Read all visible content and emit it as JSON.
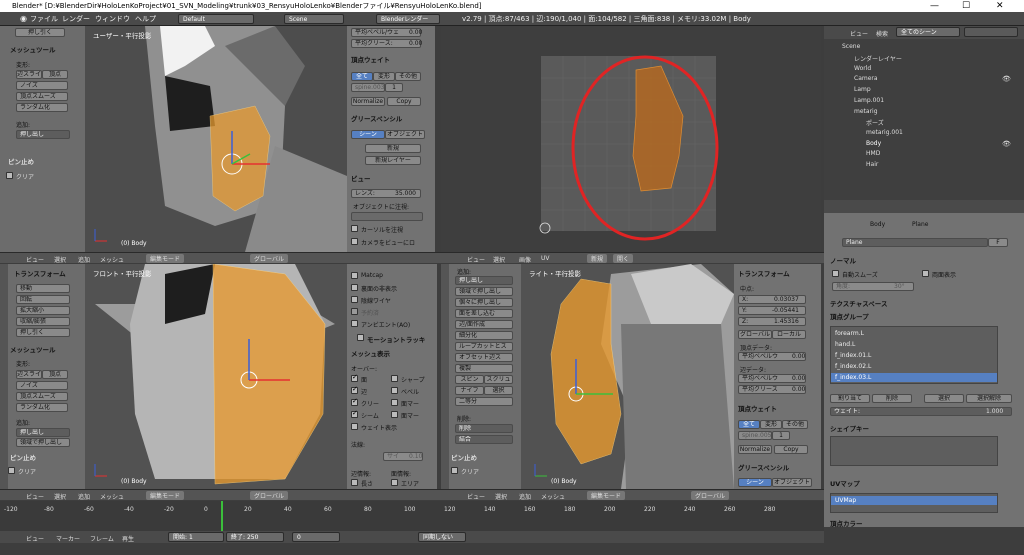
{
  "window": {
    "title": "Blender* [D:¥BlenderDir¥HoloLenKoProject¥01_SVN_Modeling¥trunk¥03_RensyuHoloLenko¥Blenderファイル¥RensyuHoloLenKo.blend]",
    "minimize": "—",
    "maximize": "☐",
    "close": "✕"
  },
  "topbar": {
    "menus": [
      "ファイル",
      "レンダー",
      "ウィンドウ",
      "ヘルプ"
    ],
    "layout": "Default",
    "scene": "Scene",
    "engine": "Blenderレンダー",
    "stats": "v2.79 | 頂点:87/463 | 辺:190/1,040 | 面:104/582 | 三角面:838 | メモリ:33.02M | Body"
  },
  "tl_toolshelf": {
    "btn_top": "押し引く",
    "mesh_tools": "メッシュツール",
    "deform": "変形:",
    "slide": "辺スライド",
    "vertex": "頂点",
    "noise": "ノイズ",
    "smooth": "頂点スムーズ",
    "random": "ランダム化",
    "add": "追加:",
    "extrude": "押し出し",
    "pin": "ピン止め",
    "clear": "クリア"
  },
  "bl_toolshelf": {
    "transform": "トランスフォーム",
    "move": "移動",
    "rotate": "回転",
    "scale": "拡大縮小",
    "shrink": "収縮/膨張",
    "pushpull": "押し引く",
    "mesh_tools": "メッシュツール",
    "deform": "変形:",
    "slide": "辺スライド",
    "vertex": "頂点",
    "noise": "ノイズ",
    "smooth": "頂点スムーズ",
    "random": "ランダム化",
    "add": "追加:",
    "extrude": "押し出し",
    "extrude_normal": "領域で押し出し",
    "pin": "ピン止め",
    "clear": "クリア"
  },
  "vp_tl": {
    "title": "ユーザー・平行投影",
    "footer": "(0) Body"
  },
  "vp_bl": {
    "title": "フロント・平行投影",
    "footer": "(0) Body"
  },
  "vp_br": {
    "title": "ライト・平行投影",
    "footer": "(0) Body"
  },
  "vhead": {
    "view": "ビュー",
    "select": "選択",
    "add": "追加",
    "mesh": "メッシュ",
    "mode": "編集モード",
    "global": "グローバル",
    "image": "画像",
    "uv": "UV",
    "new": "新規",
    "open": "開く"
  },
  "props_tl": {
    "lens1": "平均ベベル/ウェ",
    "val1": "0.00",
    "lens2": "平均クリース:",
    "val2": "0.00",
    "vw": "頂点ウェイト",
    "all": "全て",
    "deform": "変形",
    "other": "その他",
    "spine": "spine.003",
    "one": "1",
    "normalize": "Normalize",
    "copy": "Copy",
    "gp": "グリースペンシル",
    "scene": "シーン",
    "object": "オブジェクト",
    "newbtn": "新規",
    "newlayer": "新規レイヤー",
    "view": "ビュー",
    "lens": "レンズ:",
    "lensval": "35.000",
    "lock": "オブジェクトに注視:",
    "cursor": "カーソルを注視",
    "camlock": "カメラをビューにロ"
  },
  "props_bl": {
    "matcap": "Matcap",
    "backface": "裏面の非表示",
    "wire": "陰線ワイヤ",
    "reserved": "予約済",
    "ao": "アンビエント(AO)",
    "motion": "モーショントラッキ",
    "meshdisp": "メッシュ表示",
    "overlay": "オーバー:",
    "face": "面",
    "sharp": "シャープ",
    "edge": "辺",
    "bevel": "ベベル",
    "crease": "クリー",
    "seam": "シーム",
    "facemark": "面マー",
    "weight": "ウェイト表示",
    "normal": "法線:",
    "size": "サイ",
    "sizeval": "0.10",
    "edgeinfo": "辺情報:",
    "faceinfo": "面情報:",
    "length": "長さ",
    "area": "エリア"
  },
  "br_tools": {
    "header": "追加:",
    "extrude": "押し出し",
    "extrude_r": "領域で押し出し",
    "extrude_i": "個々に押し出し",
    "inset": "面を差し込む",
    "make": "辺/面作成",
    "subdivide": "細分化",
    "loopcut": "ループカットとス",
    "offset": "オフセット辺ス",
    "dup": "複製",
    "spin": "スピン",
    "screw": "スクリュ",
    "knife": "ナイフ",
    "select": "選択",
    "bisect": "二等分",
    "delete": "削除:",
    "del": "削除",
    "merge": "結合",
    "pin": "ピン止め",
    "clear": "クリア"
  },
  "br_props": {
    "transform": "トランスフォーム",
    "median": "中点:",
    "x": "X:",
    "xv": "0.03037",
    "y": "Y:",
    "yv": "-0.05441",
    "z": "Z:",
    "zv": "1.45316",
    "global": "グローバル",
    "local": "ローカル",
    "vdata": "頂点データ:",
    "bev": "平均ベベルウ",
    "bevv": "0.00",
    "edata": "辺データ:",
    "ebev": "平均ベベルウ",
    "ebevv": "0.00",
    "crease": "平均クリース",
    "creasev": "0.00",
    "vw": "頂点ウェイト",
    "all": "全て",
    "deform": "変形",
    "other": "その他",
    "spine": "spine.005",
    "one": "1",
    "normalize": "Normalize",
    "copy": "Copy",
    "gp": "グリースペンシル",
    "scene": "シーン",
    "object": "オブジェクト"
  },
  "outliner": {
    "view": "ビュー",
    "search": "検索",
    "allscenes": "全てのシーン",
    "items": [
      "Scene",
      "レンダーレイヤー",
      "World",
      "Camera",
      "Lamp",
      "Lamp.001",
      "metarig",
      "ポーズ",
      "metarig.001",
      "Body",
      "HMD",
      "Hair"
    ]
  },
  "properties": {
    "crumb_body": "Body",
    "crumb_plane": "Plane",
    "mesh": "Plane",
    "f": "F",
    "normal": "ノーマル",
    "autosmooth": "自動スムーズ",
    "doublesided": "両面表示",
    "angle": "角度:",
    "angleval": "30°",
    "texspace": "テクスチャスペース",
    "vgroups": "頂点グループ",
    "groups": [
      "forearm.L",
      "hand.L",
      "f_index.01.L",
      "f_index.02.L",
      "f_index.03.L"
    ],
    "assign": "割り当て",
    "remove": "削除",
    "select": "選択",
    "deselect": "選択解除",
    "weight": "ウェイト:",
    "weightval": "1.000",
    "shapekeys": "シェイプキー",
    "uvmaps": "UVマップ",
    "uvmap": "UVMap",
    "vcolor": "頂点カラー"
  },
  "timeline": {
    "ticks": [
      "-120",
      "-80",
      "-60",
      "-40",
      "-20",
      "0",
      "20",
      "40",
      "60",
      "80",
      "100",
      "120",
      "140",
      "160",
      "180",
      "200",
      "220",
      "240",
      "260",
      "280"
    ],
    "view": "ビュー",
    "marker": "マーカー",
    "frame": "フレーム",
    "play": "再生",
    "start": "開始:",
    "startv": "1",
    "end": "終了:",
    "endv": "250",
    "cur": "0",
    "sync": "同期しない"
  },
  "colors": {
    "mesh": "#e79a30",
    "ring": "#e02424",
    "accent": "#5680c2"
  }
}
